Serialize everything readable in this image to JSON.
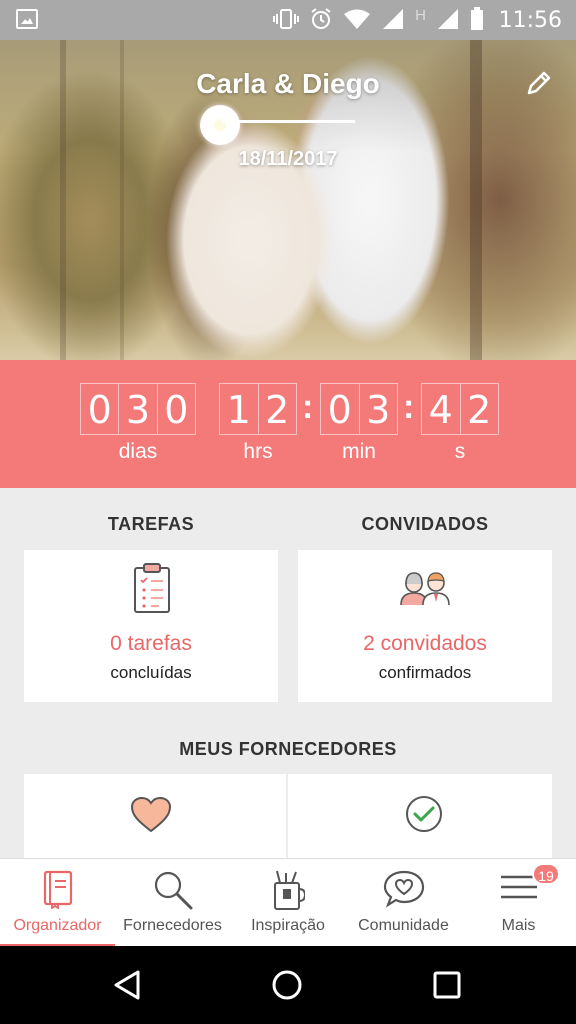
{
  "status_bar": {
    "time": "11:56",
    "network_letter": "H"
  },
  "hero": {
    "couple_name": "Carla & Diego",
    "date": "18/11/2017"
  },
  "countdown": {
    "days_digits": [
      "0",
      "3",
      "0"
    ],
    "hours_digits": [
      "1",
      "2"
    ],
    "minutes_digits": [
      "0",
      "3"
    ],
    "seconds_digits": [
      "4",
      "2"
    ],
    "units": {
      "days": "dias",
      "hours": "hrs",
      "minutes": "min",
      "seconds": "s"
    }
  },
  "tasks": {
    "title": "TAREFAS",
    "count": "0 tarefas",
    "status": "concluídas"
  },
  "guests": {
    "title": "CONVIDADOS",
    "count": "2 convidados",
    "status": "confirmados"
  },
  "vendors": {
    "title": "MEUS FORNECEDORES"
  },
  "bottom_nav": {
    "items": [
      {
        "label": "Organizador",
        "icon": "notebook-icon",
        "active": true
      },
      {
        "label": "Fornecedores",
        "icon": "search-icon",
        "active": false
      },
      {
        "label": "Inspiração",
        "icon": "inspiration-icon",
        "active": false
      },
      {
        "label": "Comunidade",
        "icon": "chat-heart-icon",
        "active": false
      },
      {
        "label": "Mais",
        "icon": "menu-icon",
        "active": false
      }
    ],
    "badge": "19"
  },
  "colors": {
    "accent": "#f47a7a",
    "accent_text": "#e96767",
    "heart": "#f6b79b",
    "check": "#3aa64a"
  }
}
